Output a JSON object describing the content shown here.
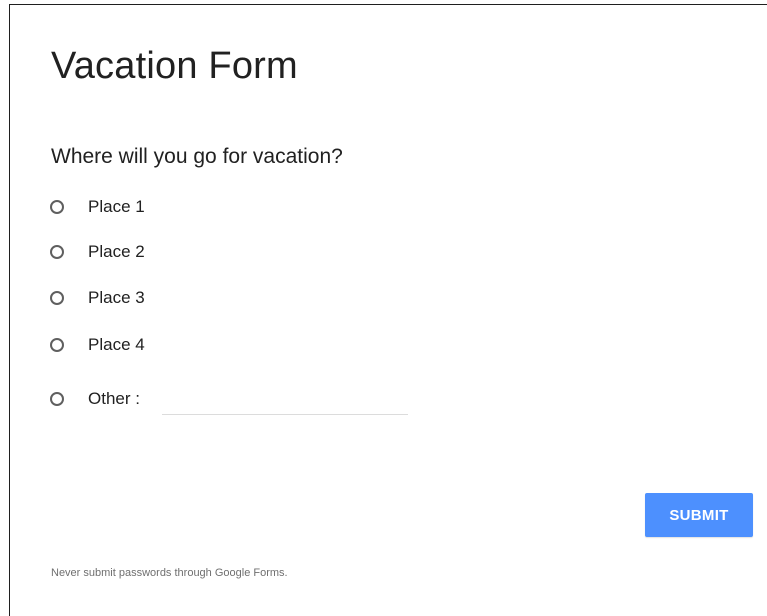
{
  "form": {
    "title": "Vacation Form",
    "question": "Where will you go for vacation?",
    "options": [
      {
        "label": "Place 1"
      },
      {
        "label": "Place 2"
      },
      {
        "label": "Place 3"
      },
      {
        "label": "Place 4"
      },
      {
        "label": "Other :"
      }
    ],
    "other_value": "",
    "submit_label": "SUBMIT",
    "footer_note": "Never submit passwords through Google Forms."
  },
  "colors": {
    "accent": "#4d90fe",
    "text": "#212121",
    "muted": "#6f6f6f"
  }
}
